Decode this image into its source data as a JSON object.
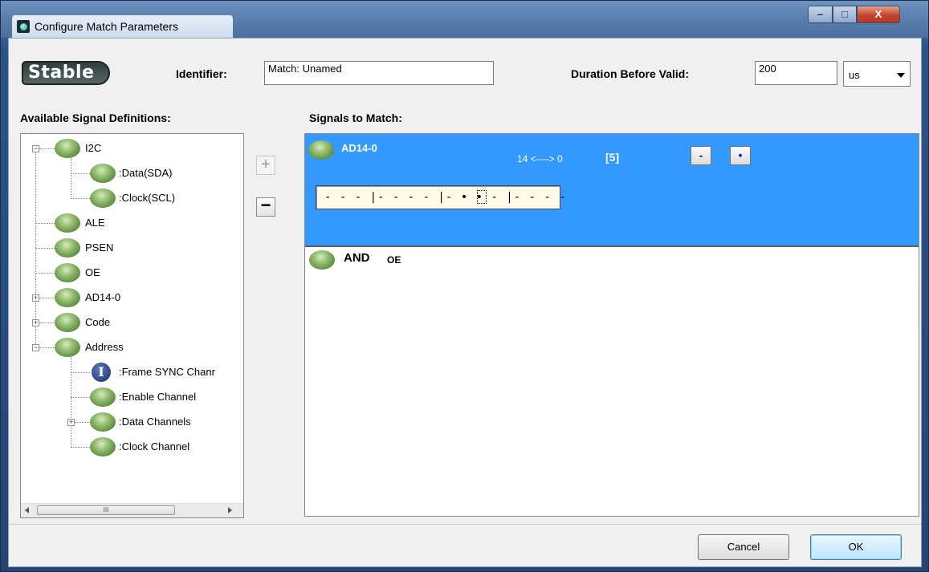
{
  "window": {
    "title": "Configure Match Parameters",
    "controls": {
      "minimize": "–",
      "maximize": "□",
      "close": "X"
    }
  },
  "header": {
    "stable_badge": "Stable",
    "identifier_label": "Identifier:",
    "identifier_value": "Match: Unamed",
    "duration_label": "Duration Before Valid:",
    "duration_value": "200",
    "unit_value": "us"
  },
  "left_panel": {
    "title": "Available Signal Definitions:",
    "tree": [
      {
        "label": "I2C",
        "expanded": true
      },
      {
        "label": ":Data(SDA)"
      },
      {
        "label": ":Clock(SCL)"
      },
      {
        "label": "ALE"
      },
      {
        "label": "PSEN"
      },
      {
        "label": "OE"
      },
      {
        "label": "AD14-0",
        "expanded": false
      },
      {
        "label": "Code",
        "expanded": false
      },
      {
        "label": "Address",
        "expanded": true
      },
      {
        "label": ":Frame SYNC Chanr",
        "icon": "info-icon",
        "icon_glyph": "I"
      },
      {
        "label": ":Enable Channel"
      },
      {
        "label": ":Data Channels",
        "expanded": false
      },
      {
        "label": ":Clock Channel"
      }
    ],
    "scroll_thumb_grip": "III"
  },
  "middle_buttons": {
    "add": "+",
    "remove": "−"
  },
  "right_panel": {
    "title": "Signals to Match:",
    "signal": {
      "name": "AD14-0",
      "range": "14 <----> 0",
      "count": "[5]",
      "minus_label": "-",
      "dot_label": "•",
      "pattern": "- - - |- - - - |- • • - |- - - -"
    },
    "and_row": {
      "operator": "AND",
      "signal": "OE"
    }
  },
  "footer": {
    "cancel": "Cancel",
    "ok": "OK"
  }
}
